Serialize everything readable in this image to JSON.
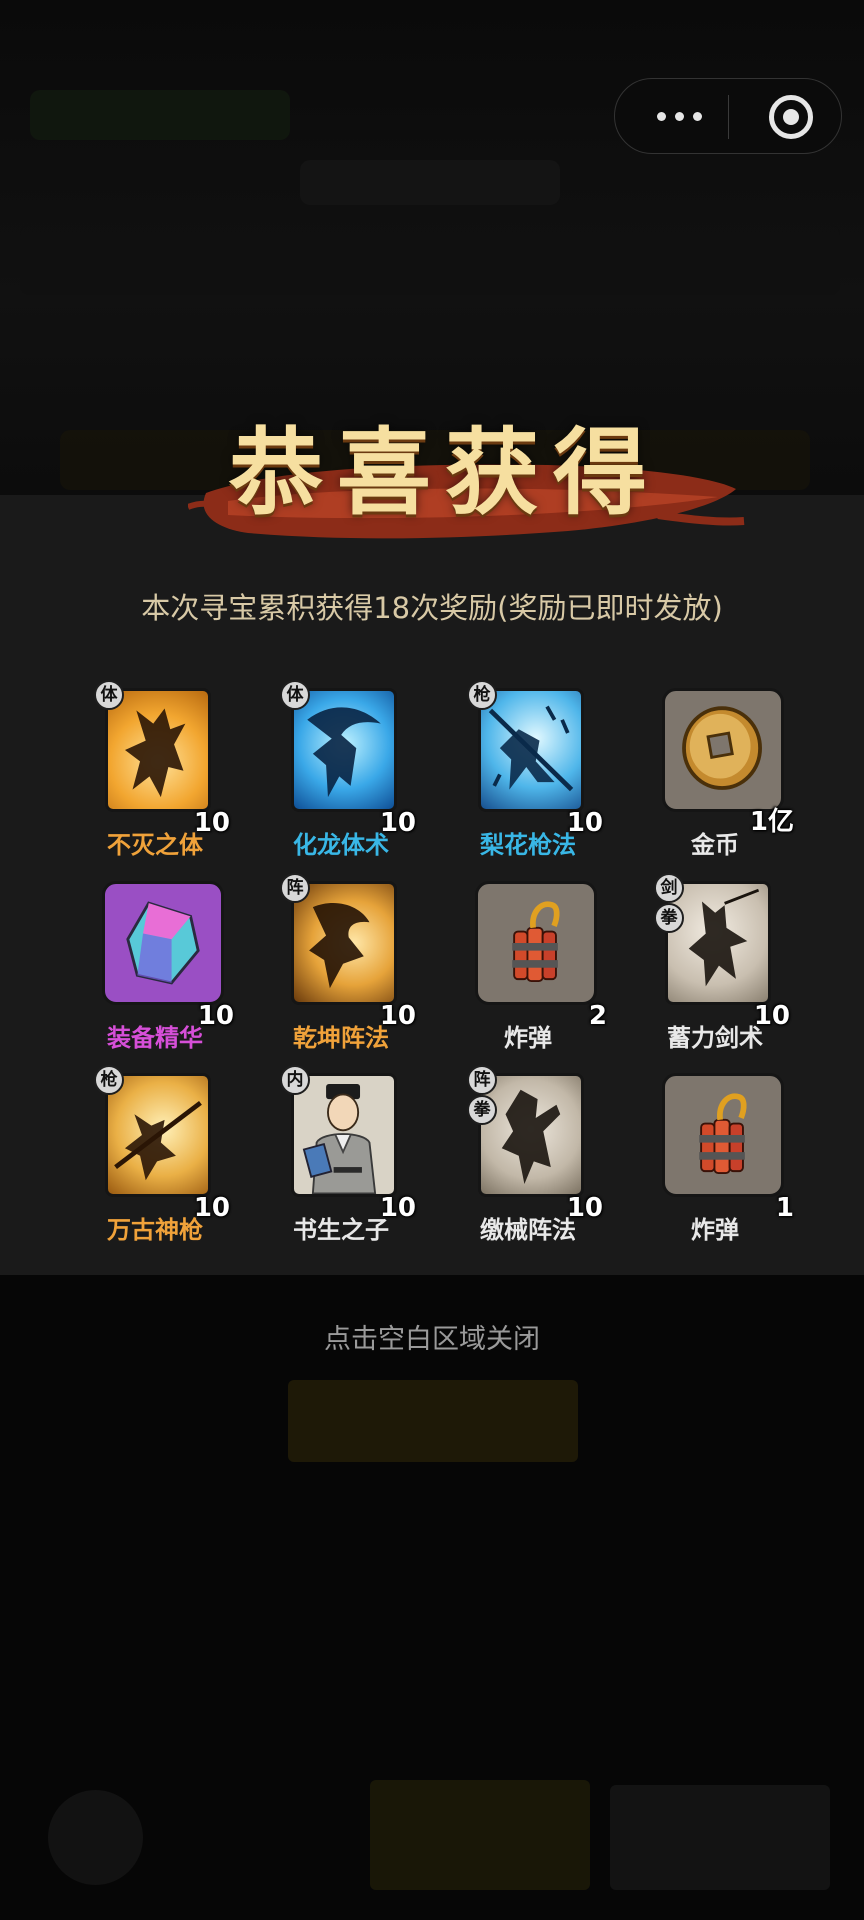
{
  "capsule": {
    "more_icon": "more-dots-icon",
    "close_icon": "target-circle-icon"
  },
  "header": {
    "title": "恭喜获得"
  },
  "summary": "本次寻宝累积获得18次奖励(奖励已即时发放)",
  "rewards": [
    {
      "name": "不灭之体",
      "qty": "10",
      "tags": [
        "体"
      ],
      "color": "#f0a23a",
      "icon": "golden-warrior-icon"
    },
    {
      "name": "化龙体术",
      "qty": "10",
      "tags": [
        "体"
      ],
      "color": "#39b7e6",
      "icon": "blue-dragon-fighter-icon"
    },
    {
      "name": "梨花枪法",
      "qty": "10",
      "tags": [
        "枪"
      ],
      "color": "#39b7e6",
      "icon": "blue-spearman-icon"
    },
    {
      "name": "金币",
      "qty": "1亿",
      "tags": [],
      "color": "#e8e8e8",
      "icon": "gold-coin-icon"
    },
    {
      "name": "装备精华",
      "qty": "10",
      "tags": [],
      "color": "#d64fd8",
      "icon": "crystal-essence-icon"
    },
    {
      "name": "乾坤阵法",
      "qty": "10",
      "tags": [
        "阵"
      ],
      "color": "#f0a23a",
      "icon": "golden-formation-icon"
    },
    {
      "name": "炸弹",
      "qty": "2",
      "tags": [],
      "color": "#e8e8e8",
      "icon": "dynamite-bomb-icon"
    },
    {
      "name": "蓄力剑术",
      "qty": "10",
      "tags": [
        "剑",
        "拳"
      ],
      "color": "#e8e8e8",
      "icon": "sword-silhouette-icon"
    },
    {
      "name": "万古神枪",
      "qty": "10",
      "tags": [
        "枪"
      ],
      "color": "#f0a23a",
      "icon": "golden-spear-icon"
    },
    {
      "name": "书生之子",
      "qty": "10",
      "tags": [
        "内"
      ],
      "color": "#e8e8e8",
      "icon": "scholar-portrait-icon"
    },
    {
      "name": "缴械阵法",
      "qty": "10",
      "tags": [
        "阵",
        "拳"
      ],
      "color": "#e8e8e8",
      "icon": "disarm-silhouette-icon"
    },
    {
      "name": "炸弹",
      "qty": "1",
      "tags": [],
      "color": "#e8e8e8",
      "icon": "dynamite-bomb-icon"
    }
  ],
  "close_hint": "点击空白区域关闭"
}
